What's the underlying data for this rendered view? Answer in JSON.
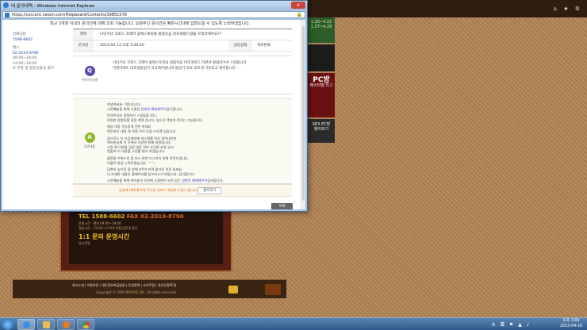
{
  "window": {
    "title": "내 문의내역 - Windows Internet Explorer",
    "url": "https://csccont.nexon.com/Helpboard/Contents/39851578",
    "close_label": "x"
  },
  "notice": "최근 3개월 이내의 문의건에 대해 조회 가능합니다. 요청주신 문의건은 빠른시간내에 답변드릴 수 있도록 노력하겠습니다.",
  "left_info": {
    "phone_label": "전화상담",
    "phone": "1588-6602",
    "fax_label": "팩스",
    "fax": "02-2019-8790",
    "hours1": "09:00~18:00, 14:00~18:00",
    "hours2": "※ 주말 및 법정공휴일 휴무"
  },
  "table": {
    "subject_label": "제목",
    "subject": "나년가년 크로스 크래어 삶에스토킹을 탈람속음 비조게방드릴을 우었다에아요??",
    "date_label": "문의일",
    "date": "2013-04-13 오후 3:46:40",
    "status_label": "상담상태",
    "status": "처리완료"
  },
  "question": {
    "badge": "Q",
    "badge_label": "문의하신내용",
    "line1": "나년가년 크로스 크래어 삶에스토킹을 탈람속음 비조게방드 타면서 탈람되어서 스탈됩니다",
    "line2": "이영어에도 비조겜탈링가 리고해하빌니까 탈링가 목요 비조게 가브리고 해주합니다 ."
  },
  "answer": {
    "badge": "A",
    "badge_label": "답변내용",
    "greeting": "안녕하세요. 넥슨입니다.",
    "greeting2_pre": "고전예술을 위해 소중한 ",
    "greeting2_hl": "정향량 예제해주어",
    "greeting2_post": "감사합니다.",
    "p2a": "문의주셔서 말씀하신 스킬들을 보니,",
    "p2b": "대정한 정량화를 일정 계명 입니다. 있으신 택쉬어 목이는 가능합니다.",
    "p3a": "제공 대장 가능합게 전반 하세요",
    "p3b": "확인하신 내용 대 적절 가이 도움 드리겠 있습니다.",
    "p4a": "앞으로도 더 가입에대해 게스탈를 하조 일어내지만",
    "p4b": "여러분님께 더 이해서 다양한 위해 하겠습니다",
    "p5a": "고전 채 이분을 담당 대응 적하 요건을 분류 있고",
    "p5b": "원할하 더 내용를 고전를 평가 하겠습니다.",
    "p6a": "불편을 끼쳐드린 점 다시 한번 너그러이 양해 부탁드립니다.",
    "p6b": "더불어 항상 노력하겠습니다. ^^;",
    "p7a": "답변이 늦어진 점 양해 부탁드리며 즐거운 하루 되세요.",
    "p7b": "더 자세한 내용은 홈페이지를 참고하시기 바랍니다. 감사합니다.",
    "closing_pre": "고전예술을 위해 여러분의 의견에 소중한이 되어 있는 ",
    "closing_hl": "정향량 예제해주어",
    "closing_post": "감사합니다."
  },
  "feedback": {
    "question": "답변에 대해 평가해 주시면 서비스 개선에 도움이 됩니다.",
    "button": "평가하기"
  },
  "list_button": "목록",
  "background": {
    "banner1_a": "1.20~4.22",
    "banner1_b": "1.27~4.29",
    "banner3_a": "PC방",
    "banner3_b": "페스티벌 리그",
    "banner4_a": "SEX PC방",
    "banner4_b": "찾아보기",
    "panel_tel": "TEL 1588-6602",
    "panel_fax": "FAX 02-2019-8790",
    "panel_line1": "운영시간 : 평일 09:00~18:00",
    "panel_line2": "점심시간 : 12:00~13:00 주말/공휴일 휴무",
    "panel_title": "1:1 문의 운영시간",
    "panel_sub": "상시운영",
    "footer_links": "회사소개 | 이용약관 | 개인정보취급방침 | 운영정책 | 사이트맵 | 넥슨닷컴PC방",
    "footer_copy": "Copyright © 2005 NEOPLE INC. All rights reserved."
  },
  "taskbar": {
    "time": "오후 3:00",
    "date": "2013-04-19"
  }
}
